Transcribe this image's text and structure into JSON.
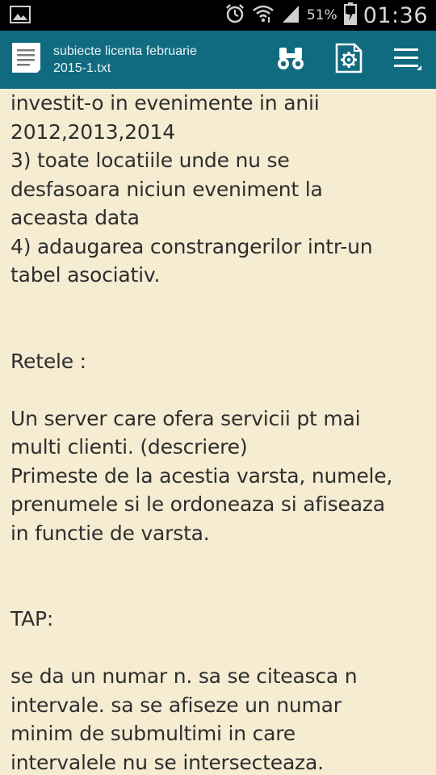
{
  "status_bar": {
    "icons": [
      "picture-icon",
      "alarm-icon",
      "wifi-icon",
      "signal-icon",
      "battery-charging-icon"
    ],
    "battery_percent": "51%",
    "time": "01:36"
  },
  "action_bar": {
    "background": "#106b80",
    "title_line1": "subiecte licenta februarie",
    "title_line2": "2015-1.txt",
    "icons": [
      "document-icon",
      "binoculars-search-icon",
      "document-settings-icon",
      "overflow-menu-icon"
    ]
  },
  "content": {
    "background": "#f5ecd2",
    "text": "investit-o in evenimente in anii\n2012,2013,2014\n3) toate locatiile unde nu se\ndesfasoara niciun eveniment la\naceasta data\n4) adaugarea constrangerilor intr-un\ntabel asociativ.\n\n\nRetele :\n\nUn server care ofera servicii pt mai\nmulti clienti. (descriere)\nPrimeste de la acestia varsta, numele,\nprenumele si le ordoneaza si afiseaza\nin functie de varsta.\n\n\nTAP:\n\nse da un numar n. sa se citeasca n\nintervale. sa se afiseze un numar\nminim de submultimi in care\nintervalele nu se intersecteaza."
  }
}
